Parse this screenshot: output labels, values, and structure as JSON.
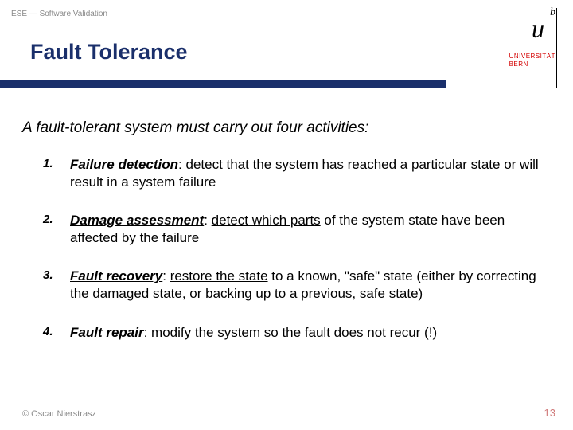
{
  "header": {
    "course_tag": "ESE — Software Validation",
    "title": "Fault Tolerance"
  },
  "logo": {
    "b": "b",
    "u": "u",
    "university_line1": "UNIVERSITÄT",
    "university_line2": "BERN"
  },
  "content": {
    "lead": "A fault-tolerant system must carry out four activities:",
    "items": [
      {
        "num": "1.",
        "term": "Failure detection",
        "sep": ": ",
        "emph": "detect",
        "rest": " that the system has reached a particular state or will result in a system failure"
      },
      {
        "num": "2.",
        "term": "Damage assessment",
        "sep": ": ",
        "emph": "detect which parts",
        "rest": " of the system state have been affected by the failure"
      },
      {
        "num": "3.",
        "term": "Fault recovery",
        "sep": ": ",
        "emph": "restore the state",
        "rest": " to a known, \"safe\" state (either by correcting the damaged state, or backing up to a previous, safe state)"
      },
      {
        "num": "4.",
        "term": "Fault repair",
        "sep": ": ",
        "emph": "modify the system",
        "rest": " so the fault does not recur (!)"
      }
    ]
  },
  "footer": {
    "copyright": "© Oscar Nierstrasz",
    "page": "13"
  }
}
